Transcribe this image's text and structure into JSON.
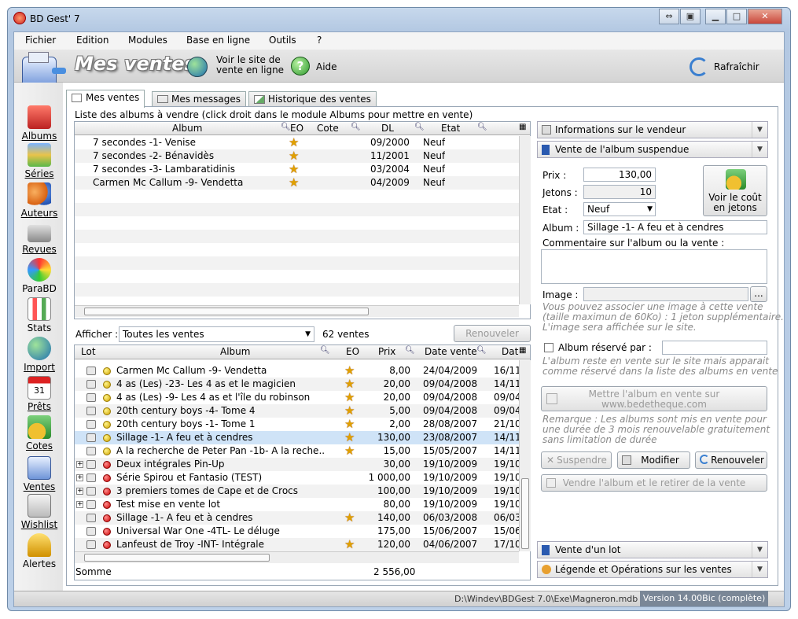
{
  "window": {
    "title": "BD Gest' 7"
  },
  "menu": [
    "Fichier",
    "Edition",
    "Modules",
    "Base en ligne",
    "Outils",
    "?"
  ],
  "toolbar": {
    "section_title": "Mes ventes",
    "online_line1": "Voir le site de",
    "online_line2": "vente en ligne",
    "help": "Aide",
    "refresh": "Rafraîchir"
  },
  "sidebar": [
    "Albums",
    "Séries",
    "Auteurs",
    "Revues",
    "ParaBD",
    "Stats",
    "Import",
    "Prêts",
    "Cotes",
    "Ventes",
    "Wishlist",
    "Alertes"
  ],
  "tabs": [
    "Mes ventes",
    "Mes messages",
    "Historique des ventes"
  ],
  "upper": {
    "caption": "Liste des albums à vendre (click droit dans le module Albums pour mettre en vente)",
    "headers": [
      "Album",
      "EO",
      "Cote",
      "DL",
      "Etat"
    ],
    "rows": [
      {
        "album": "7 secondes -1- Venise",
        "dl": "09/2000",
        "etat": "Neuf"
      },
      {
        "album": "7 secondes -2- Bénavidès",
        "dl": "11/2001",
        "etat": "Neuf"
      },
      {
        "album": "7 secondes -3- Lambaratidinis",
        "dl": "03/2004",
        "etat": "Neuf"
      },
      {
        "album": "Carmen Mc Callum -9- Vendetta",
        "dl": "04/2009",
        "etat": "Neuf"
      }
    ]
  },
  "filter": {
    "label": "Afficher :",
    "value": "Toutes les ventes",
    "count": "62 ventes",
    "renew_all": "Renouveler tout"
  },
  "lower": {
    "headers": [
      "Lot",
      "Album",
      "EO",
      "Prix",
      "Date vente",
      "Dat"
    ],
    "rows": [
      {
        "exp": false,
        "dot": "ylw",
        "album": "Carmen Mc Callum -9- Vendetta",
        "eo": true,
        "prix": "8,00",
        "date": "24/04/2009",
        "dat": "16/11"
      },
      {
        "exp": false,
        "dot": "ylw",
        "album": "4 as (Les) -23- Les 4 as et le magicien",
        "eo": true,
        "prix": "20,00",
        "date": "09/04/2008",
        "dat": "14/11"
      },
      {
        "exp": false,
        "dot": "ylw",
        "album": "4 as (Les) -9- Les 4 as et l'île du robinson",
        "eo": true,
        "prix": "20,00",
        "date": "09/04/2008",
        "dat": "09/04"
      },
      {
        "exp": false,
        "dot": "ylw",
        "album": "20th century boys -4- Tome 4",
        "eo": true,
        "prix": "5,00",
        "date": "09/04/2008",
        "dat": "09/04"
      },
      {
        "exp": false,
        "dot": "ylw",
        "album": "20th century boys -1- Tome 1",
        "eo": true,
        "prix": "2,00",
        "date": "28/08/2007",
        "dat": "21/10"
      },
      {
        "exp": false,
        "dot": "ylw",
        "album": "Sillage -1- A feu et à cendres",
        "eo": true,
        "prix": "130,00",
        "date": "23/08/2007",
        "dat": "14/11",
        "selected": true
      },
      {
        "exp": false,
        "dot": "ylw",
        "album": "A la recherche de Peter Pan -1b- A la reche...",
        "eo": true,
        "prix": "15,00",
        "date": "15/05/2007",
        "dat": "14/11"
      },
      {
        "exp": true,
        "dot": "red",
        "album": "Deux intégrales Pin-Up",
        "eo": false,
        "prix": "30,00",
        "date": "19/10/2009",
        "dat": "19/10"
      },
      {
        "exp": true,
        "dot": "red",
        "album": "Série Spirou et Fantasio (TEST)",
        "eo": false,
        "prix": "1 000,00",
        "date": "19/10/2009",
        "dat": "19/10"
      },
      {
        "exp": true,
        "dot": "red",
        "album": "3 premiers tomes de Cape et de Crocs",
        "eo": false,
        "prix": "100,00",
        "date": "19/10/2009",
        "dat": "19/10"
      },
      {
        "exp": true,
        "dot": "red",
        "album": "Test mise en vente lot",
        "eo": false,
        "prix": "80,00",
        "date": "19/10/2009",
        "dat": "19/10"
      },
      {
        "exp": false,
        "dot": "red",
        "album": "Sillage -1- A feu et à cendres",
        "eo": true,
        "prix": "140,00",
        "date": "06/03/2008",
        "dat": "06/03"
      },
      {
        "exp": false,
        "dot": "red",
        "album": "Universal War One -4TL- Le déluge",
        "eo": false,
        "prix": "175,00",
        "date": "15/06/2007",
        "dat": "15/06"
      },
      {
        "exp": false,
        "dot": "red",
        "album": "Lanfeust de Troy -INT- Intégrale",
        "eo": true,
        "prix": "120,00",
        "date": "04/06/2007",
        "dat": "17/10"
      }
    ],
    "sum_label": "Somme",
    "sum_value": "2 556,00"
  },
  "right": {
    "seller_info": "Informations sur le vendeur",
    "suspended": "Vente de l'album suspendue",
    "prix_label": "Prix :",
    "prix": "130,00",
    "jetons_label": "Jetons :",
    "jetons": "10",
    "etat_label": "Etat :",
    "etat": "Neuf",
    "cost_line1": "Voir le coût",
    "cost_line2": "en jetons",
    "album_label": "Album :",
    "album": "Sillage -1- A feu et à cendres",
    "comment_label": "Commentaire sur l'album ou la vente :",
    "image_label": "Image :",
    "image_browse": "...",
    "image_note1": "Vous pouvez associer une image à cette vente",
    "image_note2": "(taille maximun de 60Ko) : 1 jeton supplémentaire.",
    "image_note3": "L'image sera affichée sur le site.",
    "reserved_label": "Album réservé par :",
    "reserved_note1": "L'album reste en vente sur le site mais apparait",
    "reserved_note2": "comme réservé dans la liste des albums en vente",
    "put_online1": "Mettre l'album en vente sur",
    "put_online2": "www.bedetheque.com",
    "remark1": "Remarque : Les albums sont mis en vente pour",
    "remark2": "une durée de 3 mois renouvelable gratuitement",
    "remark3": "sans limitation de durée",
    "suspend": "Suspendre",
    "modify": "Modifier",
    "renew": "Renouveler",
    "sell_remove": "Vendre l'album et le retirer de la vente",
    "lot_sale": "Vente d'un lot",
    "legend": "Légende et Opérations sur les ventes"
  },
  "status": {
    "path": "D:\\Windev\\BDGest 7.0\\Exe\\Magneron.mdb",
    "version": "Version 14.00Bic (complète)"
  }
}
